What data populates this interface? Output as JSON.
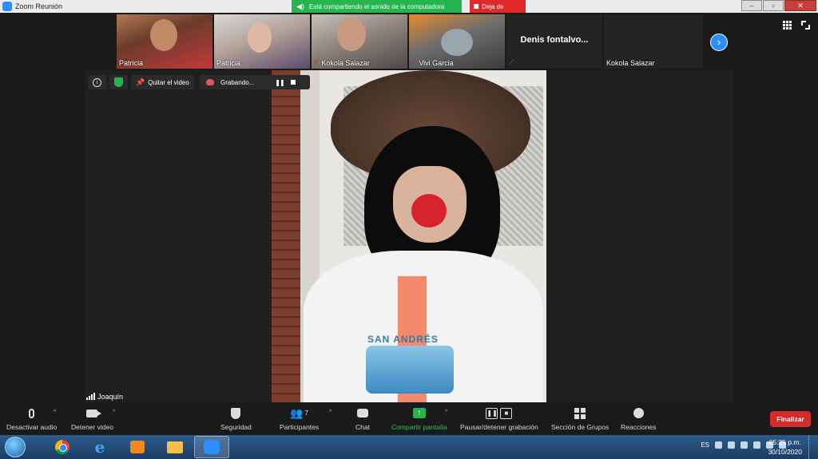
{
  "window": {
    "title": "Zoom Reunión"
  },
  "share_banner": {
    "text": "Está compartiendo el sonido de la computadora",
    "stop_label": "Deja de"
  },
  "participants": [
    {
      "name": "Patricia",
      "muted": false
    },
    {
      "name": "Patricia",
      "muted": false
    },
    {
      "name": "Kokola Salazar",
      "muted": true
    },
    {
      "name": "Vivi Garcia",
      "muted": true
    },
    {
      "name": "Denis  fontalvo...",
      "muted": true,
      "video": false
    },
    {
      "name": "Kokola Salazar",
      "muted": false,
      "video": false
    }
  ],
  "stage": {
    "tools": {
      "unpin_label": "Quitar el video",
      "recording_label": "Grabando..."
    },
    "active_speaker": "Joaquín",
    "shirt_text": "SAN ANDRÉS"
  },
  "toolbar": {
    "mute": "Desactivar audio",
    "video": "Detener video",
    "security": "Seguridad",
    "participants": "Participantes",
    "participants_count": "7",
    "chat": "Chat",
    "share": "Compartir pantalla",
    "record": "Pausar/detener grabación",
    "breakout": "Sección de Grupos",
    "reactions": "Reacciones",
    "end": "Finalizar"
  },
  "taskbar": {
    "language": "ES",
    "time": "05:25 p.m.",
    "date": "30/10/2020"
  },
  "colors": {
    "zoom_blue": "#2d8cff",
    "share_green": "#26b44f",
    "end_red": "#d42a2a"
  }
}
